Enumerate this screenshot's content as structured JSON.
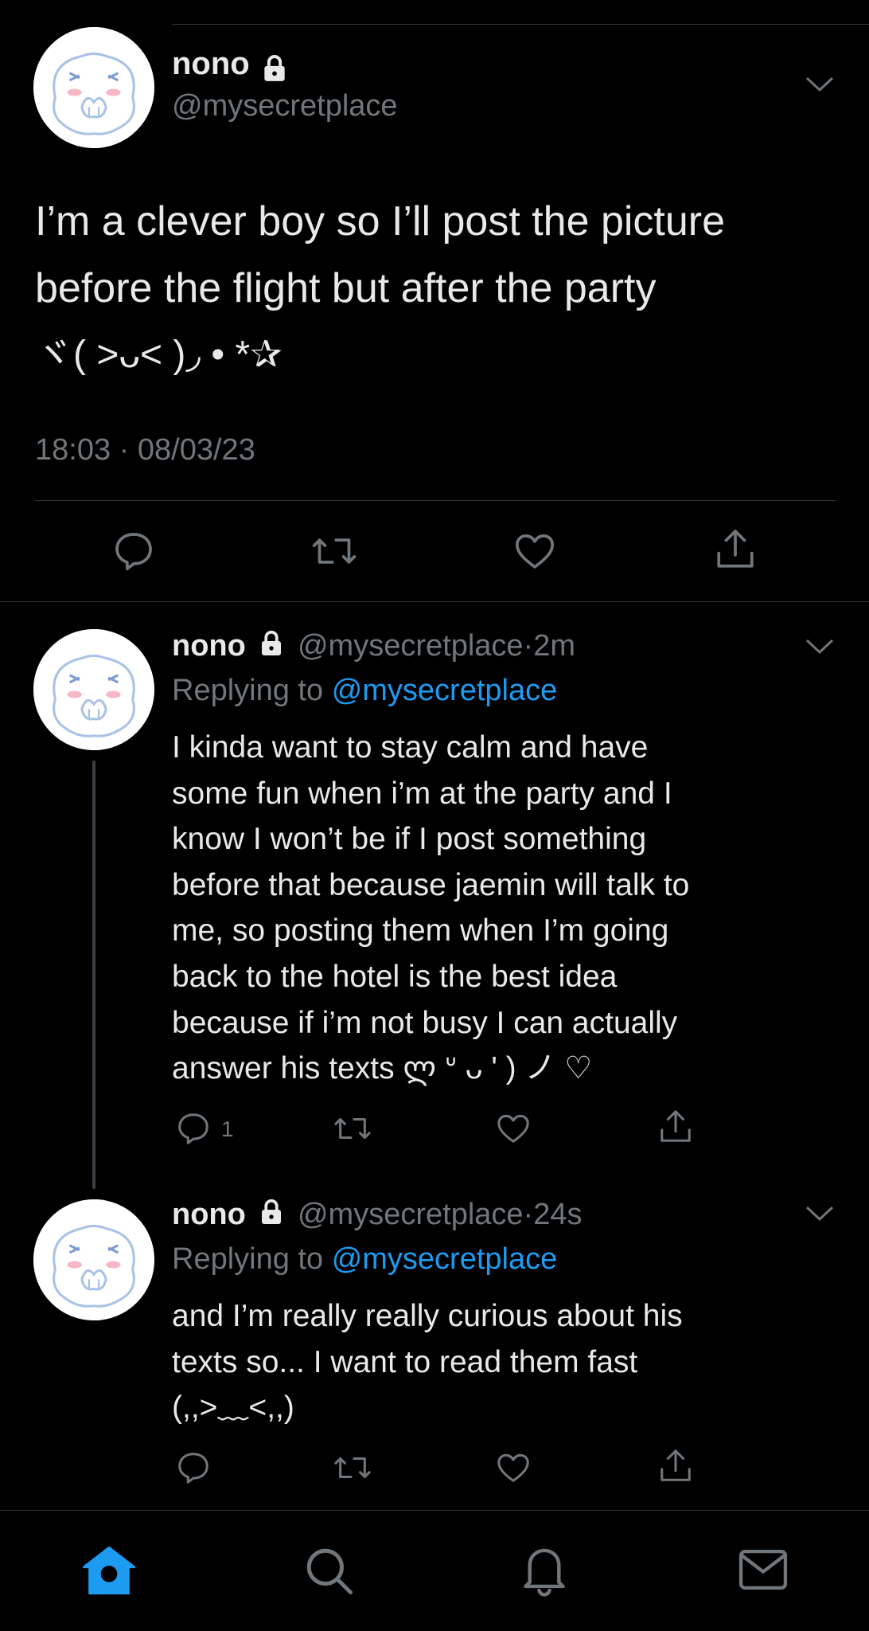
{
  "main_tweet": {
    "display_name": "nono",
    "handle": "@mysecretplace",
    "text_line1": "I’m a clever boy so I’ll post the picture",
    "text_line2": "before the flight but after the party",
    "text_line3": "ヾ( ˃ᴗ˂ )◞ • *✰",
    "time": "18:03",
    "separator": "·",
    "date": "08/03/23"
  },
  "replies": [
    {
      "display_name": "nono",
      "handle": "@mysecretplace",
      "separator": "·",
      "age": "2m",
      "replying_prefix": "Replying to",
      "replying_to": "@mysecretplace",
      "lines": [
        "I kinda want to stay calm and have",
        "some fun when i’m at the party and I",
        "know I won’t be if I post something",
        "before that because jaemin will talk to",
        "me, so posting them when I’m going",
        "back to the hotel is the best idea",
        "because if i’m not busy I can actually",
        "answer his texts ლ ᐡ ᴗ ' ) ノ ♡"
      ],
      "reply_count": "1"
    },
    {
      "display_name": "nono",
      "handle": "@mysecretplace",
      "separator": "·",
      "age": "24s",
      "replying_prefix": "Replying to",
      "replying_to": "@mysecretplace",
      "lines": [
        "and I’m really really curious about his",
        "texts so... I want to read them fast",
        "(,,>﹏<,,)"
      ]
    }
  ],
  "bottom_nav": [
    {
      "icon": "home-icon",
      "active": true
    },
    {
      "icon": "search-icon",
      "active": false
    },
    {
      "icon": "bell-icon",
      "active": false
    },
    {
      "icon": "mail-icon",
      "active": false
    }
  ],
  "colors": {
    "background": "#000000",
    "text": "#e7e9ea",
    "muted": "#71767b",
    "accent": "#1d9bf0",
    "divider": "#2f3336"
  }
}
